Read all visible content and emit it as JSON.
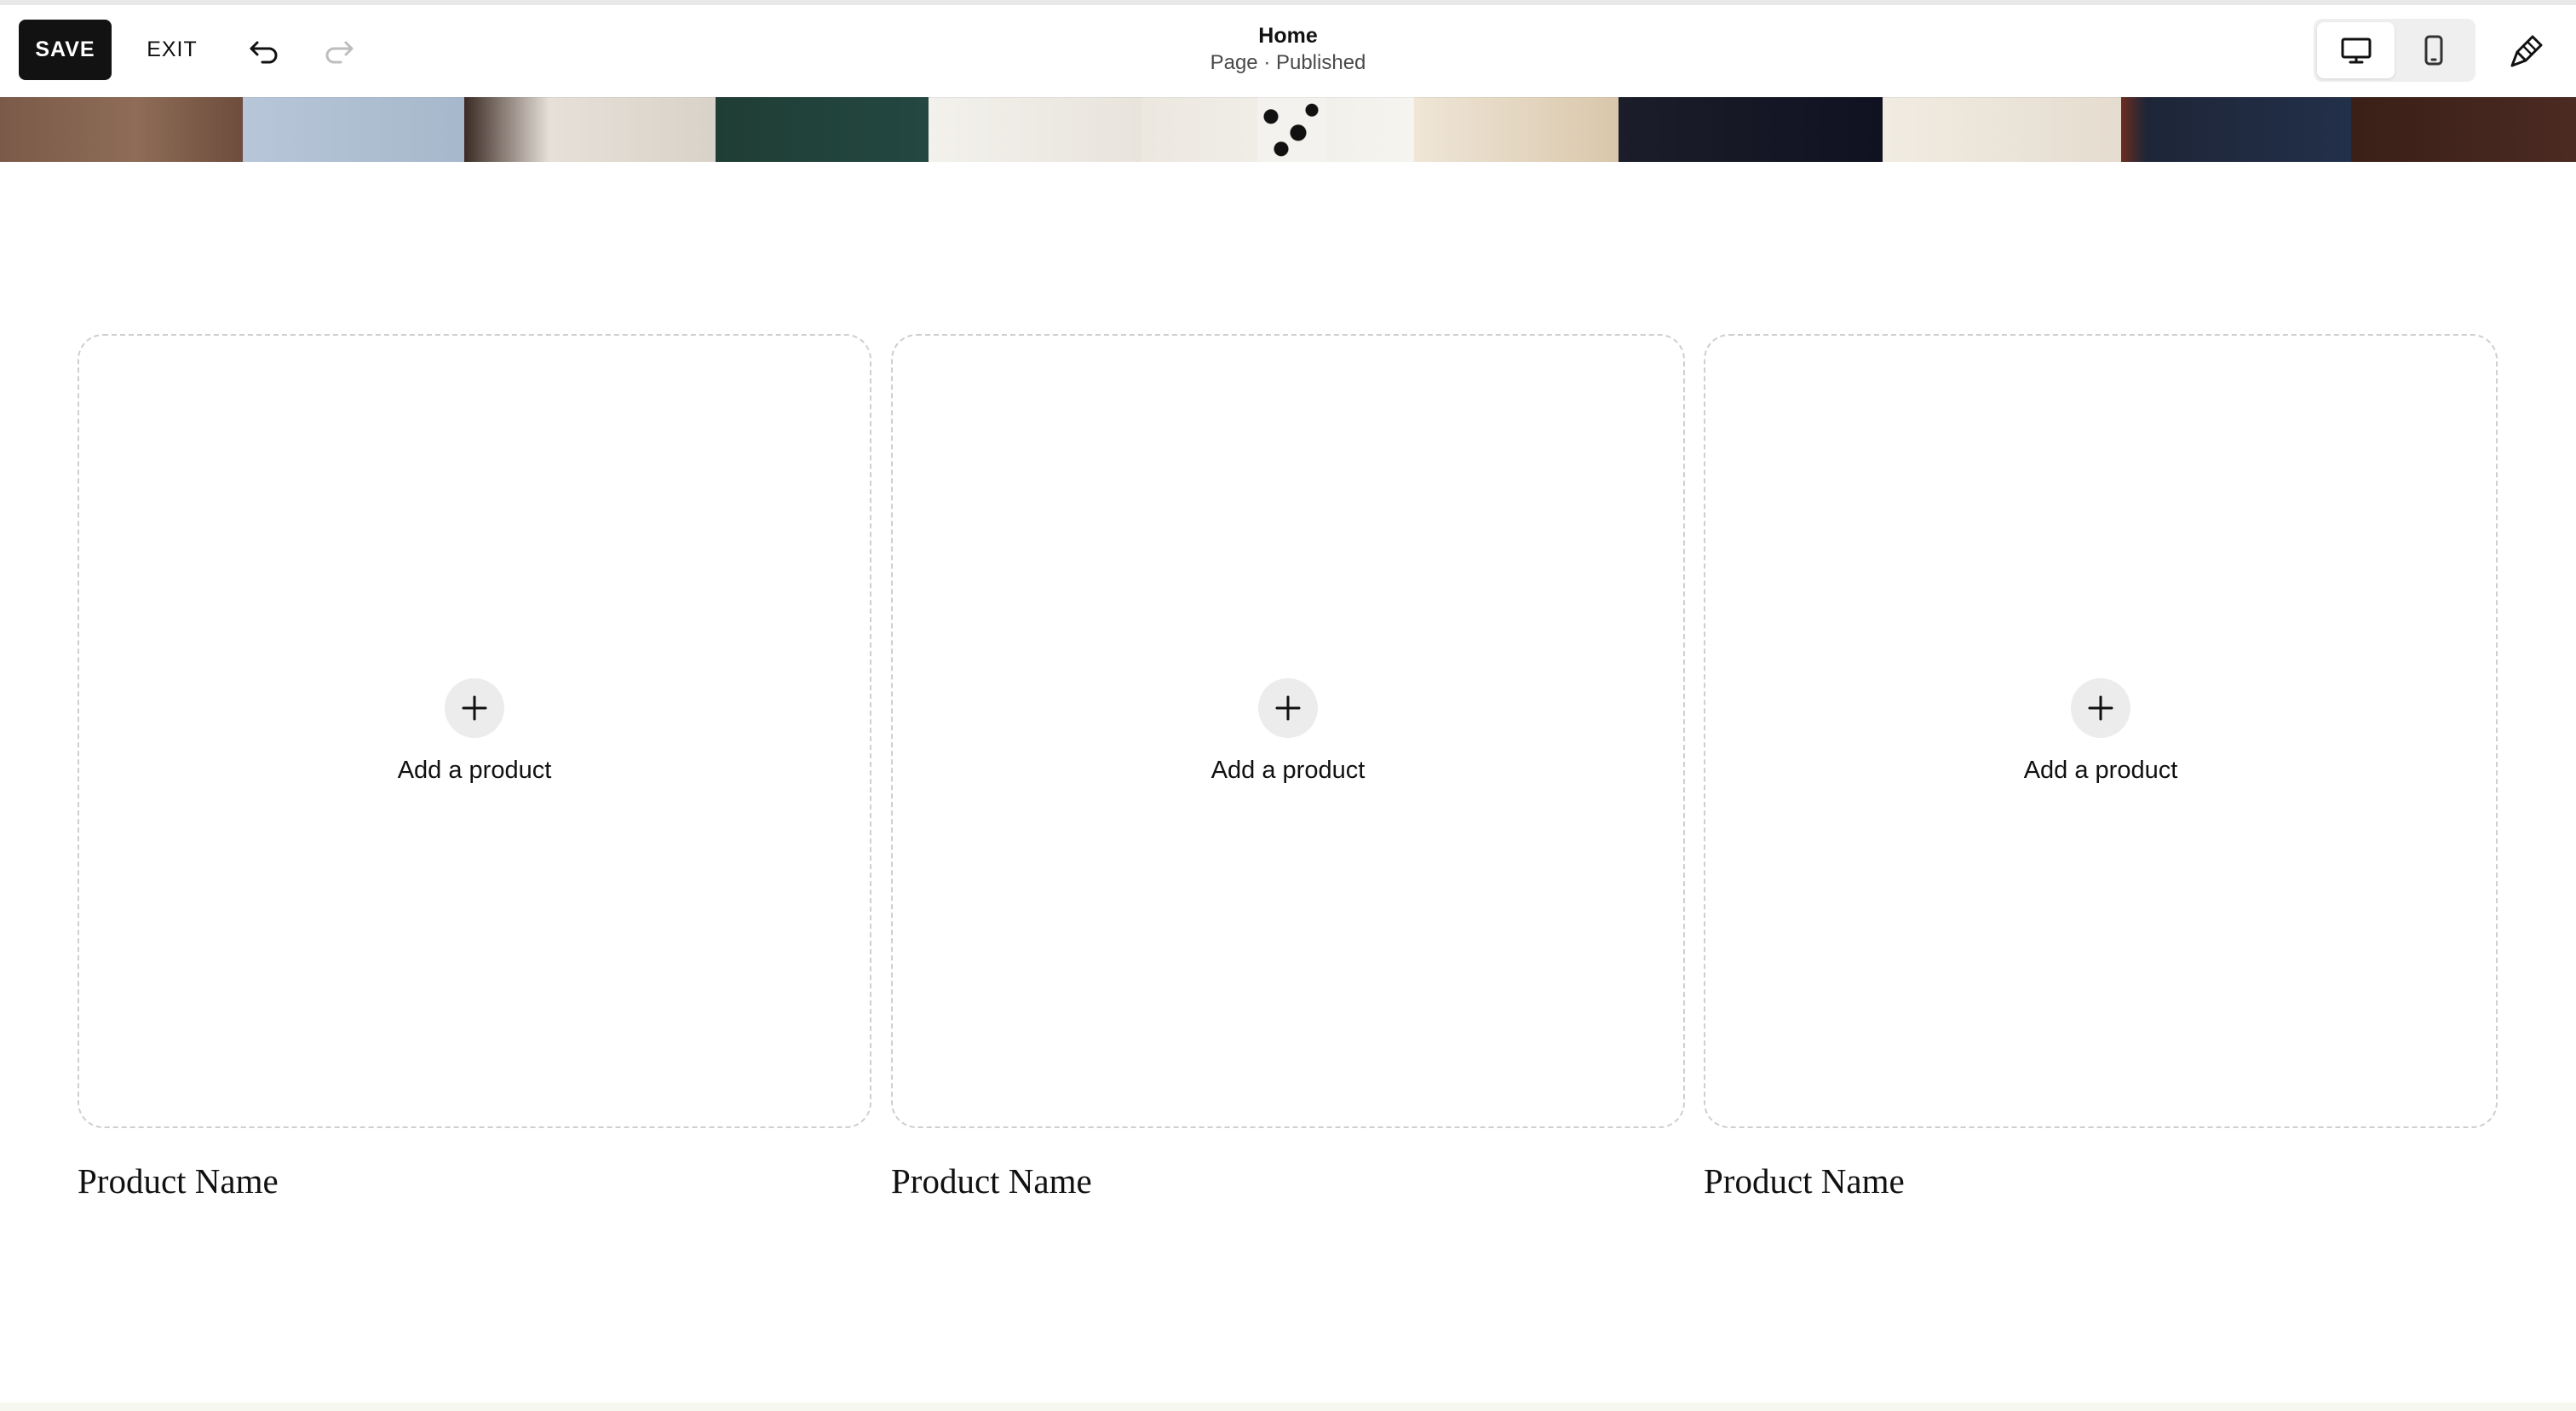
{
  "toolbar": {
    "save_label": "SAVE",
    "exit_label": "EXIT",
    "undo_icon": "undo-icon",
    "redo_icon": "redo-icon",
    "page_title": "Home",
    "page_status": "Page · Published",
    "device_options": [
      "desktop-icon",
      "mobile-icon"
    ],
    "selected_device": "desktop",
    "design_icon": "paintbrush-icon"
  },
  "hero": {
    "description_icon": "hero-image"
  },
  "products": [
    {
      "add_label": "Add a product",
      "name": "Product Name",
      "icon": "plus-icon"
    },
    {
      "add_label": "Add a product",
      "name": "Product Name",
      "icon": "plus-icon"
    },
    {
      "add_label": "Add a product",
      "name": "Product Name",
      "icon": "plus-icon"
    }
  ],
  "colors": {
    "save_bg": "#121212",
    "card_border": "#cfcfcf",
    "add_circle_bg": "#ececec"
  }
}
